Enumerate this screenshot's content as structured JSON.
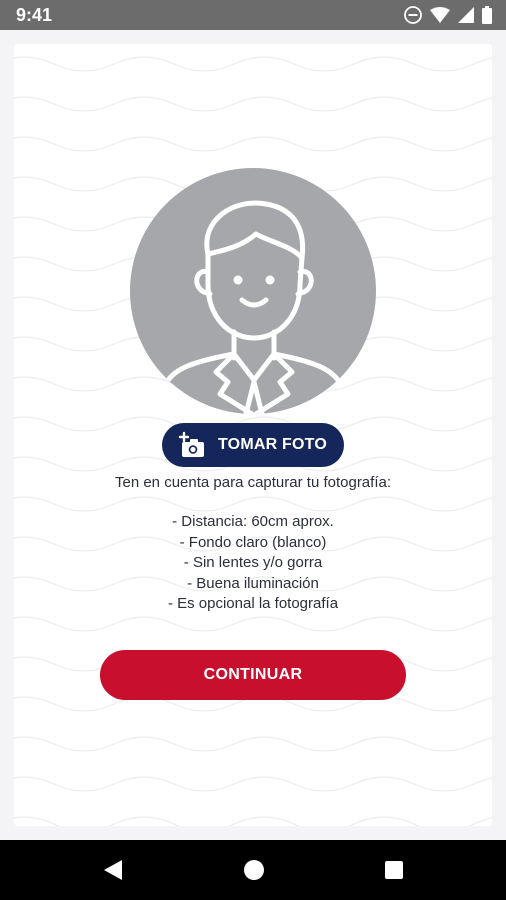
{
  "status_bar": {
    "time": "9:41",
    "icons": [
      "do-not-disturb-icon",
      "wifi-icon",
      "cell-signal-icon",
      "battery-icon"
    ]
  },
  "photo": {
    "avatar_icon": "user-placeholder-icon",
    "button_icon": "add-camera-icon",
    "button_label": "TOMAR FOTO"
  },
  "instructions": {
    "intro": "Ten en cuenta para capturar tu fotografía:",
    "tips": [
      "- Distancia: 60cm aprox.",
      "- Fondo claro (blanco)",
      "- Sin lentes y/o gorra",
      "- Buena iluminación",
      "- Es opcional la fotografía"
    ]
  },
  "continue_label": "CONTINUAR",
  "nav_bar": {
    "icons": [
      "back-icon",
      "home-icon",
      "recents-icon"
    ]
  },
  "colors": {
    "primary_navy": "#14265a",
    "accent_red": "#c8102e",
    "avatar_gray": "#a5a7aa",
    "status_bar": "#6c6c6c"
  }
}
